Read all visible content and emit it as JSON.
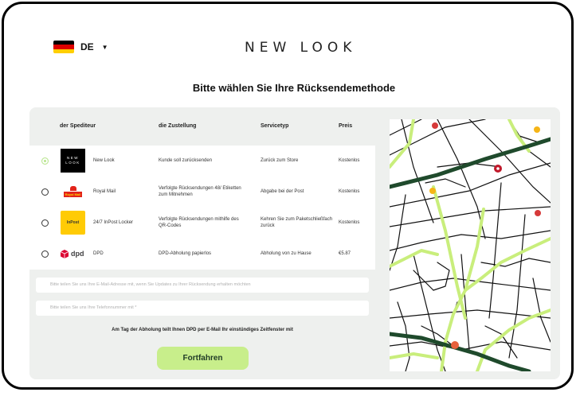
{
  "header": {
    "language_code": "DE",
    "chevron_icon": "chevron-down-icon",
    "logo_text": "NEW LOOK",
    "flag_colors": [
      "#000000",
      "#dd0000",
      "#ffce00"
    ]
  },
  "page": {
    "title": "Bitte wählen Sie Ihre Rücksendemethode"
  },
  "table": {
    "headers": {
      "carrier": "der Spediteur",
      "delivery": "die Zustellung",
      "service_type": "Servicetyp",
      "price": "Preis"
    },
    "rows": [
      {
        "selected": true,
        "logo": "newlook-logo",
        "logo_text": "NEW LOOK",
        "carrier": "New Look",
        "delivery": "Kunde soll zurücksenden",
        "service": "Zurück zum Store",
        "price": "Kostenlos"
      },
      {
        "selected": false,
        "logo": "royal-mail-logo",
        "logo_text": "Royal Mail",
        "carrier": "Royal Mail",
        "delivery": "Verfolgte Rücksendungen 48/ Etiketten zum Mitnehmen",
        "service": "Abgabe bei der Post",
        "price": "Kostenlos"
      },
      {
        "selected": false,
        "logo": "inpost-logo",
        "logo_text": "InPost",
        "carrier": "24/7 InPost Locker",
        "delivery": "Verfolgte Rücksendungen mithilfe des QR-Codes",
        "service": "Kehren Sie zum Paketschließfach zurück",
        "price": "Kostenlos"
      },
      {
        "selected": false,
        "logo": "dpd-logo",
        "logo_text": "dpd",
        "carrier": "DPD",
        "delivery": "DPD-Abholung papierlos",
        "service": "Abholung von zu Hause",
        "price": "€5.87"
      }
    ]
  },
  "form": {
    "email_placeholder": "Bitte teilen Sie uns Ihre E-Mail-Adresse mit, wenn Sie Updates zu Ihrer Rücksendung erhalten möchten",
    "phone_placeholder": "Bitte teilen Sie uns Ihre Telefonnummer mit *",
    "note": "Am Tag der Abholung teilt Ihnen DPD per E-Mail Ihr einstündiges Zeitfenster mit",
    "continue_label": "Fortfahren"
  },
  "colors": {
    "accent": "#c8ee8b",
    "panel": "#eef0ee",
    "map_road_major": "#1f4a2c",
    "map_road_green": "#c9ee7c"
  }
}
